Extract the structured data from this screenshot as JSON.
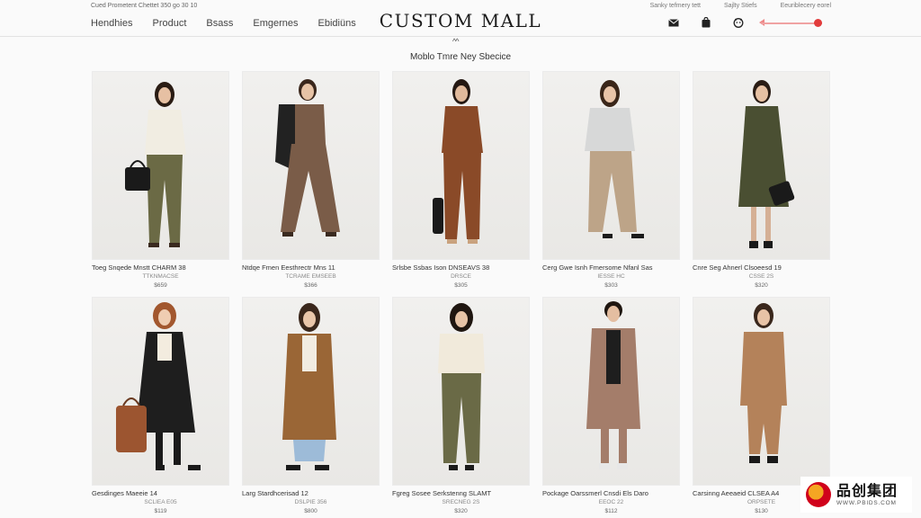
{
  "header": {
    "promo": "Cued Prometent Chettet 350 go 30 10",
    "top_links": [
      "Sanky tefmery tett",
      "Sajlty  Stiefs",
      "Eeuriblecery eorel"
    ],
    "nav": [
      "Hendhies",
      "Product",
      "Bsass",
      "Emgernes",
      "Ebidiüns"
    ],
    "logo": "CUSTOM MALL",
    "icons": [
      "mail-icon",
      "bag-icon",
      "user-icon"
    ],
    "accent_color": "#e23c3c"
  },
  "chevron": "^^",
  "section_title": "Moblo Tmre Ney Sbecice",
  "products": [
    {
      "name": "Toeg Snqede Mnstt CHARM 38",
      "sub": "TTKNMACSE",
      "price": "$659"
    },
    {
      "name": "Ntdqe Fmen Eesthrectr Mns 11",
      "sub": "TCRAME EMSEEB",
      "price": "$366"
    },
    {
      "name": "Srlsbe Ssbas Ison DNSEAVS 38",
      "sub": "DRSCE",
      "price": "$305"
    },
    {
      "name": "Cerg Gwe Isnh Fmersome Nfanl Sas",
      "sub": "IESSE HC",
      "price": "$303"
    },
    {
      "name": "Cnre Seg Ahnerl Clsoeesd 19",
      "sub": "CSSE 2S",
      "price": "$320"
    },
    {
      "name": "Gesdinges Maeeie 14",
      "sub": "SCLIEA E05",
      "price": "$119"
    },
    {
      "name": "Larg Stardhcerisad 12",
      "sub": "DSLPIE 356",
      "price": "$800"
    },
    {
      "name": "Fgreg Sosee Serkstenng SLAMT",
      "sub": "SRECNEG 2S",
      "price": "$320"
    },
    {
      "name": "Pockage Oarssmerl Cnsdi Els Daro",
      "sub": "EEOC 22",
      "price": "$112"
    },
    {
      "name": "Carsinng Aeeaeid CLSEA A4",
      "sub": "ORPSETE",
      "price": "$130"
    }
  ],
  "watermark": {
    "cn": "品创集团",
    "en": "WWW.PBIDS.COM"
  }
}
